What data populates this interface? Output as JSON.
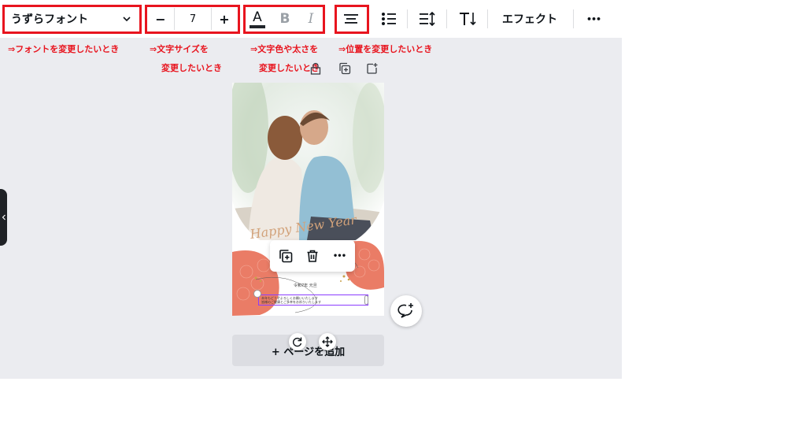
{
  "toolbar": {
    "font_name": "うずらフォント",
    "font_size": "7",
    "size_minus": "−",
    "size_plus": "+",
    "text_color_glyph": "A",
    "bold_glyph": "B",
    "italic_glyph": "I",
    "effects_label": "エフェクト",
    "more_glyph": "•••"
  },
  "annotations": {
    "font": "⇒フォントを変更したいとき",
    "size_line1": "⇒文字サイズを",
    "size_line2": "変更したいとき",
    "color_line1": "⇒文字色や太さを",
    "color_line2": "変更したいとき",
    "align": "⇒位置を変更したいとき"
  },
  "design": {
    "headline": "Happy New Year",
    "date_line": "令和7年 元旦",
    "message_line1": "本年もどうぞよろしくお願いいたします",
    "message_line2": "皆様のご健康とご多幸をお祈りいたします"
  },
  "add_page_label": "+ ページを追加",
  "colors": {
    "highlight": "#e8141e",
    "accent": "#8b3dff",
    "coral": "#ea7c66"
  }
}
